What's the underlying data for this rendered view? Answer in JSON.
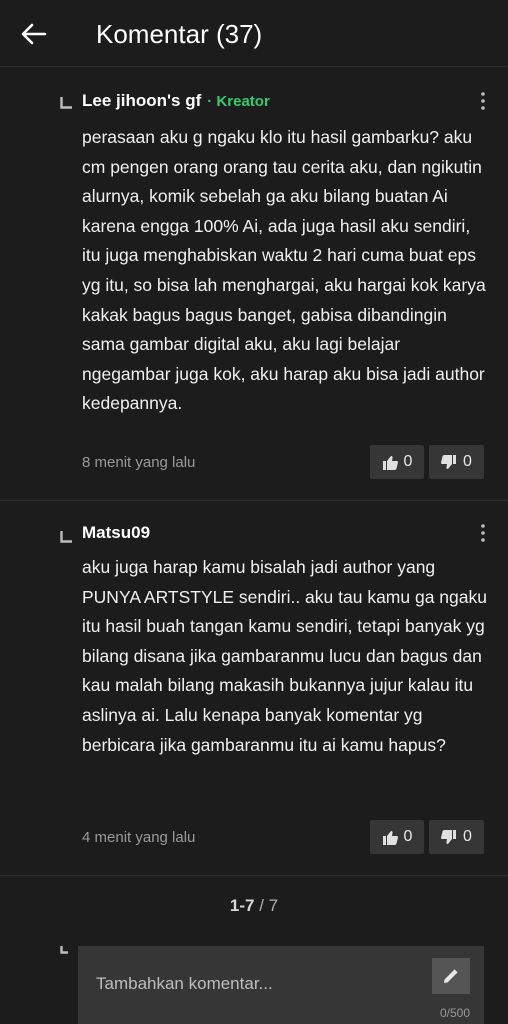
{
  "header": {
    "title": "Komentar (37)"
  },
  "comments": [
    {
      "author": "Lee jihoon's gf",
      "badge": "· Kreator",
      "text": "perasaan aku g ngaku klo itu hasil gambarku? aku cm pengen orang orang tau cerita aku, dan ngikutin alurnya, komik sebelah ga aku bilang buatan Ai karena engga 100% Ai, ada juga hasil aku sendiri, itu juga menghabiskan waktu 2 hari cuma buat eps yg itu, so bisa lah menghargai, aku hargai kok karya kakak bagus bagus banget, gabisa dibandingin sama gambar digital aku, aku lagi belajar ngegambar juga kok, aku harap aku bisa jadi author kedepannya.",
      "time": "8 menit yang lalu",
      "likes": "0",
      "dislikes": "0"
    },
    {
      "author": "Matsu09",
      "text": "aku juga harap kamu bisalah jadi author yang PUNYA ARTSTYLE sendiri.. aku tau kamu ga ngaku itu hasil buah tangan kamu sendiri, tetapi banyak yg bilang disana jika gambaranmu lucu dan bagus dan kau malah bilang makasih bukannya jujur kalau itu aslinya ai. Lalu kenapa banyak komentar yg berbicara jika gambaranmu itu ai kamu hapus?",
      "time": "4 menit yang lalu",
      "likes": "0",
      "dislikes": "0"
    }
  ],
  "pagination": {
    "current": "1-7",
    "separator": " / ",
    "total": "7"
  },
  "input": {
    "placeholder": "Tambahkan komentar...",
    "char_count": "0/500"
  },
  "colors": {
    "creator_badge": "#2ecf6e",
    "background": "#1c1c1c",
    "button_bg": "#363636"
  }
}
